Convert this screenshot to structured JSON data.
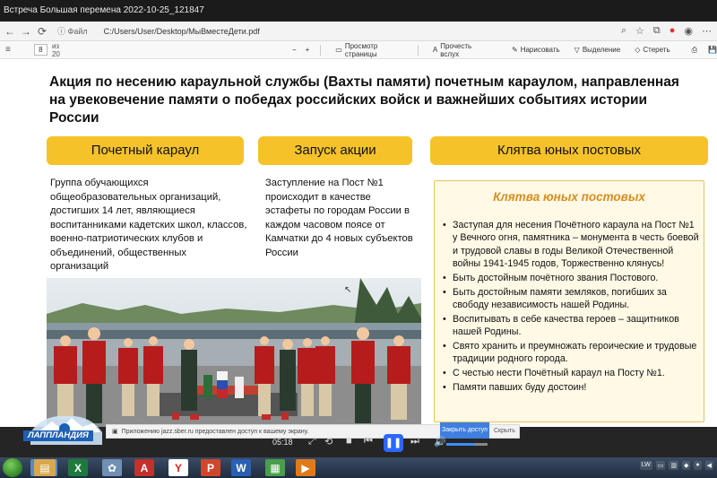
{
  "window": {
    "title": "Встреча Большая перемена 2022-10-25_121847"
  },
  "browser": {
    "file_label": "Файл",
    "url": "C:/Users/User/Desktop/МыВместеДети.pdf"
  },
  "pdf_toolbar": {
    "page": "8",
    "page_count": "из 20",
    "tools": {
      "view_label": "Просмотр страницы",
      "read_aloud_label": "Прочесть вслух",
      "draw_label": "Нарисовать",
      "highlight_label": "Выделение",
      "erase_label": "Стереть"
    }
  },
  "slide": {
    "headline": "Акция по несению караульной службы (Вахты памяти) почетным караулом, направленная на увековечение памяти о победах российских войск и важнейших событиях истории России",
    "columns": [
      {
        "heading": "Почетный караул",
        "text": "Группа обучающихся общеобразовательных организаций, достигших 14 лет, являющиеся воспитанниками кадетских школ, классов, военно-патриотических клубов и объединений, общественных организаций"
      },
      {
        "heading": "Запуск акции",
        "text": "Заступление на Пост №1 происходит в качестве эстафеты по городам России в каждом часовом поясе от Камчатки до 4 новых субъектов России"
      },
      {
        "heading": "Клятва юных постовых"
      }
    ],
    "oath": {
      "title": "Клятва юных постовых",
      "items": [
        "Заступая для несения Почётного караула на Пост №1 у Вечного огня, памятника – монумента в честь боевой и трудовой славы в годы Великой Отечественной войны 1941-1945 годов, Торжественно клянусь!",
        "Быть достойным почётного звания Постового.",
        "Быть достойным памяти земляков, погибших за свободу независимость нашей Родины.",
        "Воспитывать в себе качества героев – защитников нашей Родины.",
        "Свято хранить и преумножать героические и трудовые традиции родного города.",
        "С честью нести Почётный караул на Посту №1.",
        "Памяти павших буду достоин!"
      ]
    }
  },
  "notification": {
    "text": "Приложению jazz.sber.ru предоставлен доступ к вашему экрану.",
    "allow_label": "Закрыть доступ",
    "hide_label": "Скрыть"
  },
  "player": {
    "time": "05:18"
  },
  "logo": {
    "text": "ЛАППЛАНДИЯ"
  },
  "colors": {
    "accent_yellow": "#f5c22a",
    "oath_title": "#d98d1b",
    "player_blue": "#2d66ff"
  }
}
